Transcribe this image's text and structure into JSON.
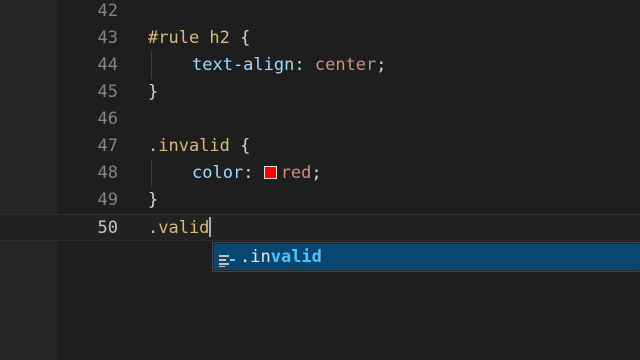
{
  "editor": {
    "colors": {
      "background": "#1e1e1e",
      "selector": "#d7ba7d",
      "property": "#9cdcfe",
      "value": "#ce9178",
      "swatch": "#ff0000",
      "suggest_selected": "#094771"
    },
    "lines": [
      {
        "number": "42",
        "text": ""
      },
      {
        "number": "43",
        "selector": "#rule h2",
        "brace": "{"
      },
      {
        "number": "44",
        "property": "text-align",
        "colon": ":",
        "value": "center",
        "semi": ";"
      },
      {
        "number": "45",
        "brace": "}"
      },
      {
        "number": "46",
        "text": ""
      },
      {
        "number": "47",
        "selector": ".invalid",
        "brace": "{"
      },
      {
        "number": "48",
        "property": "color",
        "colon": ":",
        "value": "red",
        "semi": ";"
      },
      {
        "number": "49",
        "brace": "}"
      },
      {
        "number": "50",
        "text": ".valid"
      }
    ]
  },
  "suggest": {
    "icon": "property-icon",
    "label_prefix": ".in",
    "label_match": "valid"
  }
}
